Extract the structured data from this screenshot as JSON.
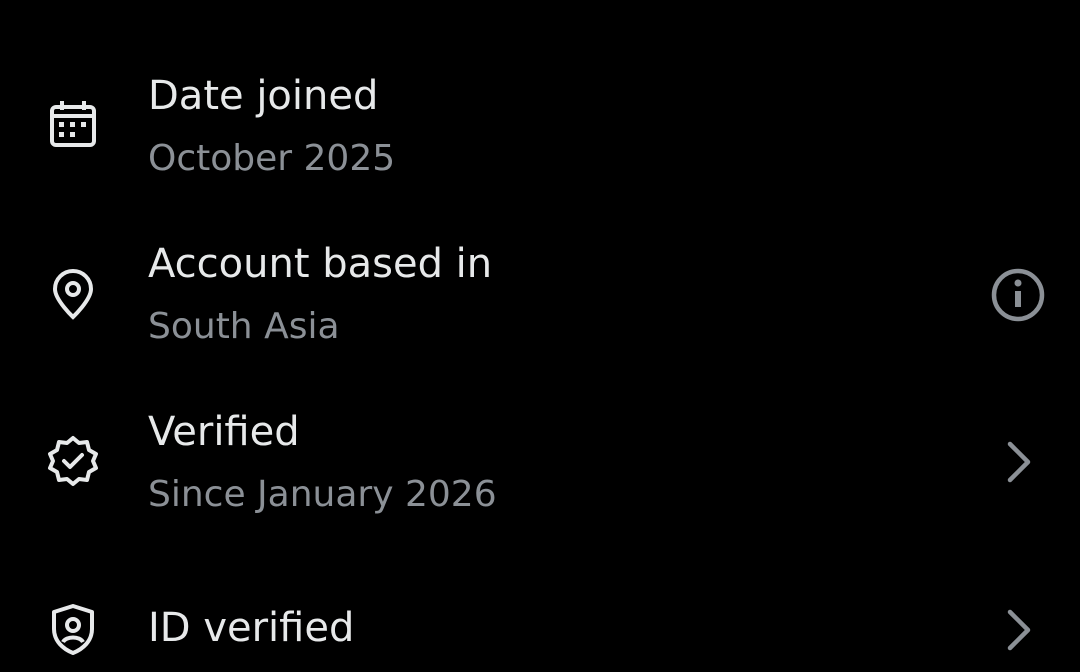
{
  "items": [
    {
      "title": "Date joined",
      "subtitle": "October 2025",
      "icon": "calendar-icon",
      "trailing": "none"
    },
    {
      "title": "Account based in",
      "subtitle": "South Asia",
      "icon": "location-pin-icon",
      "trailing": "info-icon"
    },
    {
      "title": "Verified",
      "subtitle": "Since January 2026",
      "icon": "verified-badge-icon",
      "trailing": "chevron-right-icon"
    },
    {
      "title": "ID verified",
      "subtitle": "",
      "icon": "id-shield-icon",
      "trailing": "chevron-right-icon"
    }
  ],
  "colors": {
    "background": "#000000",
    "primary_text": "#e7e9ea",
    "secondary_text": "#8b9096",
    "icon": "#e7e9ea",
    "trailing_icon": "#8b9096"
  }
}
